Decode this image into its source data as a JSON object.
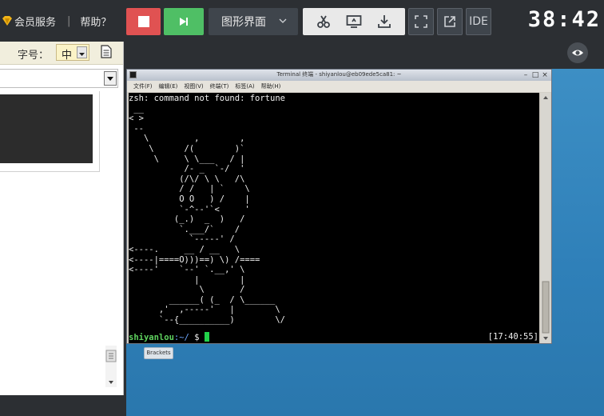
{
  "header": {
    "vip_label": "会员服务",
    "separator": "|",
    "help_label": "帮助？",
    "mode_label": "图形界面",
    "ide_label": "IDE",
    "timer": "38:42"
  },
  "left_panel": {
    "font_label": "字号：",
    "font_value": "中"
  },
  "terminal": {
    "title": "Terminal 终端 - shiyanlou@eb09ede5ca81: ~",
    "menu": [
      "文件(F)",
      "编辑(E)",
      "视图(V)",
      "终端(T)",
      "标签(A)",
      "帮助(H)"
    ],
    "output": "zsh: command not found: fortune\n __\n< >\n --\n   \\         ,        ,\n    \\      /(        )`\n     \\     \\ \\___   / |\n           /- _  `-/  '\n          (/\\/ \\ \\   /\\\n          / /   | `    \\\n          O O   ) /    |\n          `-^--'`<     '\n         (_.)  _  )   /\n          `.___/`    /\n            `-----' /\n<----.     __ / __   \\\n<----|====O)))==) \\) /====\n<----'    `--' `.__,' \\\n             |        |\n              \\       /\n        ______( (_  / \\______\n      ,'  ,-----'   |        \\\n      `--{__________)        \\/",
    "prompt_user": "shiyanlou",
    "prompt_path": ":~/",
    "prompt_symbol": " $ ",
    "clock": "[17:40:55]"
  },
  "desktop": {
    "tooltip": "Brackets"
  },
  "colors": {
    "stop": "#e05252",
    "run": "#4fbf65",
    "topbar": "#2c2f33",
    "desktop": "#3589c0",
    "prompt_user": "#5fd35f",
    "cursor": "#22d14a"
  },
  "icons": {
    "vip": "vip-diamond-icon",
    "stop": "stop-icon",
    "run": "run-icon",
    "cut": "scissors-icon",
    "screen": "screen-share-icon",
    "download": "download-icon",
    "fullscreen": "fullscreen-icon",
    "popout": "popout-icon",
    "eye": "eye-icon"
  }
}
